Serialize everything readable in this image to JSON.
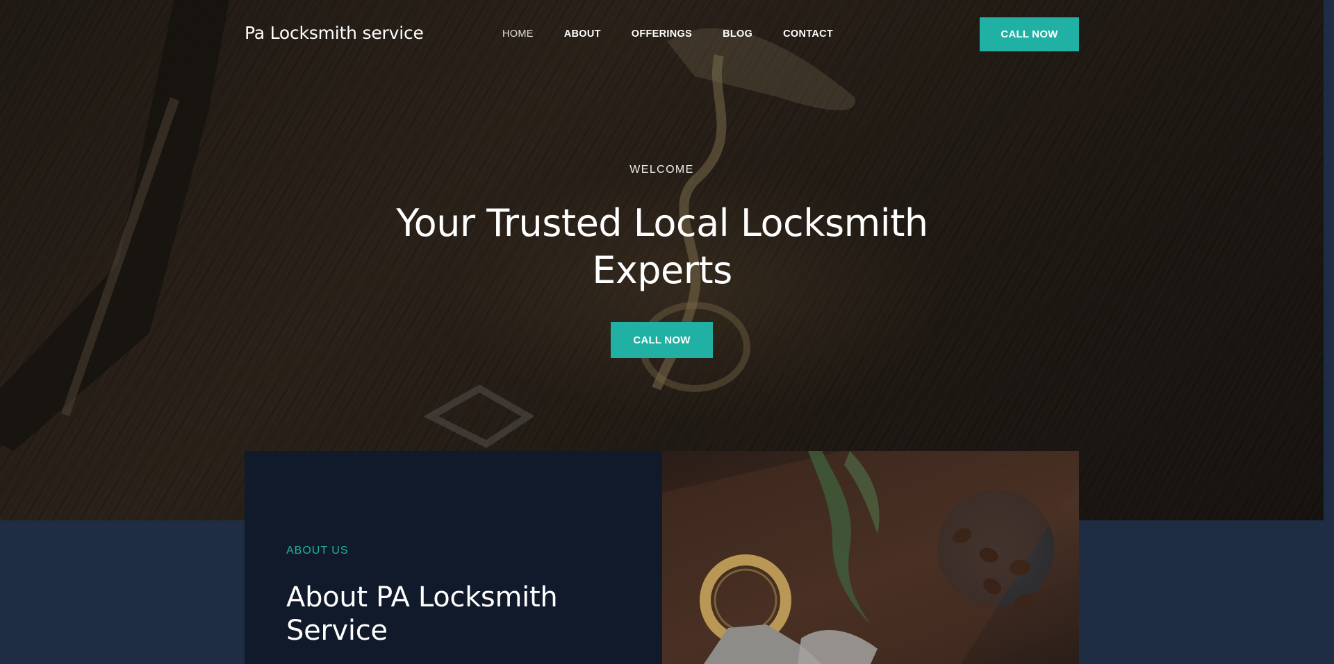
{
  "brand": {
    "name": "Pa Locksmith service"
  },
  "nav": {
    "items": [
      {
        "label": "HOME"
      },
      {
        "label": "ABOUT"
      },
      {
        "label": "OFFERINGS"
      },
      {
        "label": "BLOG"
      },
      {
        "label": "CONTACT"
      }
    ],
    "cta_label": "CALL NOW"
  },
  "hero": {
    "eyebrow": "WELCOME",
    "headline": "Your Trusted Local Locksmith Experts",
    "cta_label": "CALL NOW"
  },
  "about": {
    "eyebrow": "ABOUT US",
    "title": "About PA Locksmith Service"
  },
  "colors": {
    "accent": "#21b1a4",
    "card": "#111a2b",
    "band": "#1f2d44"
  }
}
